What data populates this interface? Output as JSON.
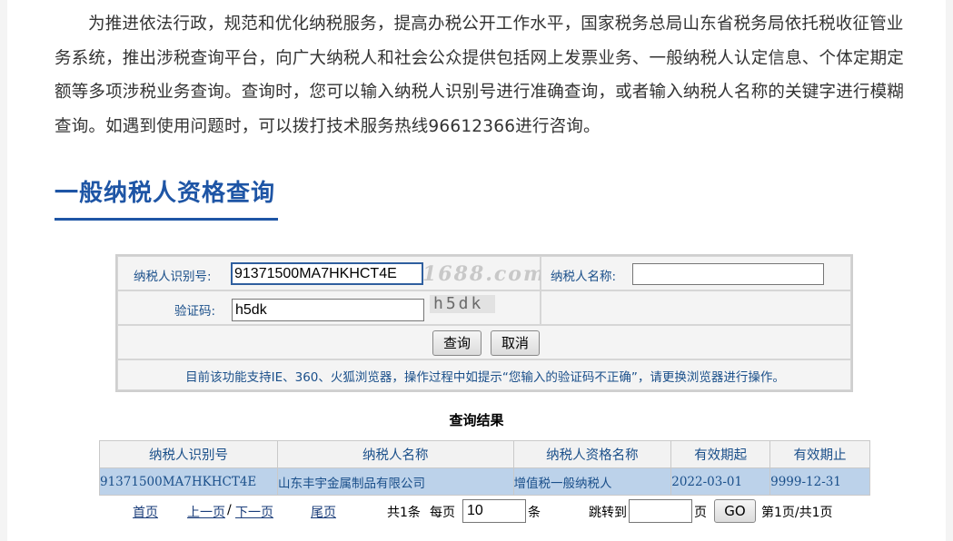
{
  "intro": {
    "text": "为推进依法行政，规范和优化纳税服务，提高办税公开工作水平，国家税务总局山东省税务局依托税收征管业务系统，推出涉税查询平台，向广大纳税人和社会公众提供包括网上发票业务、一般纳税人认定信息、个体定期定额等多项涉税业务查询。查询时，您可以输入纳税人识别号进行准确查询，或者输入纳税人名称的关键字进行模糊查询。如遇到使用问题时，可以拨打技术服务热线96612366进行咨询。"
  },
  "section": {
    "title": "一般纳税人资格查询"
  },
  "form": {
    "tax_id_label": "纳税人识别号:",
    "tax_id_value": "91371500MA7HKHCT4E",
    "name_label": "纳税人名称:",
    "name_value": "",
    "captcha_label": "验证码:",
    "captcha_value": "h5dk",
    "captcha_image_text": "h5dk",
    "watermark": "1688.com",
    "query_button": "查询",
    "cancel_button": "取消",
    "note": "目前该功能支持IE、360、火狐浏览器，操作过程中如提示“您输入的验证码不正确”，请更换浏览器进行操作。"
  },
  "results": {
    "title": "查询结果",
    "columns": [
      "纳税人识别号",
      "纳税人名称",
      "纳税人资格名称",
      "有效期起",
      "有效期止"
    ],
    "rows": [
      [
        "91371500MA7HKHCT4E",
        "山东丰宇金属制品有限公司",
        "增值税一般纳税人",
        "2022-03-01",
        "9999-12-31"
      ]
    ]
  },
  "pager": {
    "first": "首页",
    "prev": "上一页",
    "slash": "/",
    "next": "下一页",
    "last": "尾页",
    "total": "共1条",
    "per_page_label": "每页",
    "per_page_value": "10",
    "unit_items": "条",
    "jump_label": "跳转到",
    "jump_value": "",
    "unit_page": "页",
    "go": "GO",
    "status": "第1页/共1页"
  },
  "colors": {
    "accent": "#1e55a5",
    "link": "#1a4f8a",
    "row_highlight": "#bcd2ea"
  }
}
